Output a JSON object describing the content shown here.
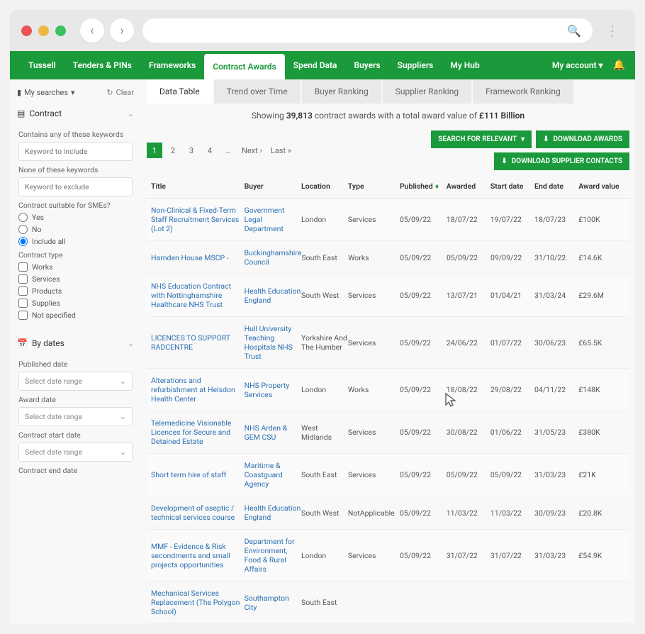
{
  "nav": {
    "items": [
      "Tussell",
      "Tenders & PINs",
      "Frameworks",
      "Contract Awards",
      "Spend Data",
      "Buyers",
      "Suppliers",
      "My Hub"
    ],
    "active_index": 3,
    "account": "My account"
  },
  "sidebar": {
    "my_searches": "My searches",
    "clear": "Clear",
    "contract": {
      "title": "Contract",
      "contains_label": "Contains any of these keywords",
      "contains_placeholder": "Keyword to include",
      "none_label": "None of these keywords",
      "none_placeholder": "Keyword to exclude",
      "sme_label": "Contract suitable for SMEs?",
      "sme_yes": "Yes",
      "sme_no": "No",
      "sme_all": "Include all",
      "type_label": "Contract type",
      "types": [
        "Works",
        "Services",
        "Products",
        "Supplies",
        "Not specified"
      ]
    },
    "dates": {
      "title": "By dates",
      "published": "Published date",
      "award": "Award date",
      "start": "Contract start date",
      "end": "Contract end date",
      "placeholder": "Select date range"
    }
  },
  "tabs": {
    "items": [
      "Data Table",
      "Trend over Time",
      "Buyer Ranking",
      "Supplier Ranking",
      "Framework Ranking"
    ],
    "active_index": 0
  },
  "summary": {
    "prefix": "Showing ",
    "count": "39,813",
    "mid": " contract awards with a total award value of ",
    "value": "£111 Billion"
  },
  "pager": {
    "pages": [
      "1",
      "2",
      "3",
      "4",
      "…"
    ],
    "next": "Next ›",
    "last": "Last »"
  },
  "actions": {
    "search_relevant": "SEARCH FOR RELEVANT",
    "download_awards": "DOWNLOAD AWARDS",
    "download_contacts": "DOWNLOAD SUPPLIER CONTACTS"
  },
  "table": {
    "headers": [
      "Title",
      "Buyer",
      "Location",
      "Type",
      "Published",
      "Awarded",
      "Start date",
      "End date",
      "Award value"
    ],
    "rows": [
      {
        "title": "Non-Clinical & Fixed-Term Staff Recruitment Services (Lot 2)",
        "buyer": "Government Legal Department",
        "location": "London",
        "type": "Services",
        "published": "05/09/22",
        "awarded": "18/07/22",
        "start": "19/07/22",
        "end": "18/07/23",
        "value": "£100K"
      },
      {
        "title": "Harnden House MSCP -",
        "buyer": "Buckinghamshire Council",
        "location": "South East",
        "type": "Works",
        "published": "05/09/22",
        "awarded": "05/09/22",
        "start": "09/09/22",
        "end": "31/10/22",
        "value": "£14.6K"
      },
      {
        "title": "NHS Education Contract with Nottinghamshire Healthcare NHS Trust",
        "buyer": "Health Education England",
        "location": "South West",
        "type": "Services",
        "published": "05/09/22",
        "awarded": "13/07/21",
        "start": "01/04/21",
        "end": "31/03/24",
        "value": "£29.6M"
      },
      {
        "title": "LICENCES TO SUPPORT RADCENTRE",
        "buyer": "Hull University Teaching Hospitals NHS Trust",
        "location": "Yorkshire And The Humber",
        "type": "Services",
        "published": "05/09/22",
        "awarded": "24/06/22",
        "start": "01/07/22",
        "end": "30/06/23",
        "value": "£65.5K"
      },
      {
        "title": "Alterations and refurbishment at Helsdon Health Center",
        "buyer": "NHS Property Services",
        "location": "London",
        "type": "Works",
        "published": "05/09/22",
        "awarded": "18/08/22",
        "start": "29/08/22",
        "end": "04/11/22",
        "value": "£148K"
      },
      {
        "title": "Telemedicine Visionable Licences for Secure and Detained Estate",
        "buyer": "NHS Arden & GEM CSU",
        "location": "West Midlands",
        "type": "Services",
        "published": "05/09/22",
        "awarded": "30/08/22",
        "start": "01/06/22",
        "end": "31/05/23",
        "value": "£380K"
      },
      {
        "title": "Short term hire of staff",
        "buyer": "Maritime & Coastguard Agency",
        "location": "South East",
        "type": "Services",
        "published": "05/09/22",
        "awarded": "05/09/22",
        "start": "05/09/22",
        "end": "31/03/23",
        "value": "£21K"
      },
      {
        "title": "Development of aseptic / technical services course",
        "buyer": "Health Education England",
        "location": "South West",
        "type": "NotApplicable",
        "published": "05/09/22",
        "awarded": "11/03/22",
        "start": "11/03/22",
        "end": "30/09/23",
        "value": "£20.8K"
      },
      {
        "title": "MMF - Evidence & Risk secondments and small projects opportunities",
        "buyer": "Department for Environment, Food & Rural Affairs",
        "location": "London",
        "type": "Services",
        "published": "05/09/22",
        "awarded": "31/07/22",
        "start": "31/07/22",
        "end": "31/03/23",
        "value": "£54.9K"
      },
      {
        "title": "Mechanical Services Replacement (The Polygon School)",
        "buyer": "Southampton City",
        "location": "South East",
        "type": "",
        "published": "",
        "awarded": "",
        "start": "",
        "end": "",
        "value": ""
      }
    ]
  }
}
